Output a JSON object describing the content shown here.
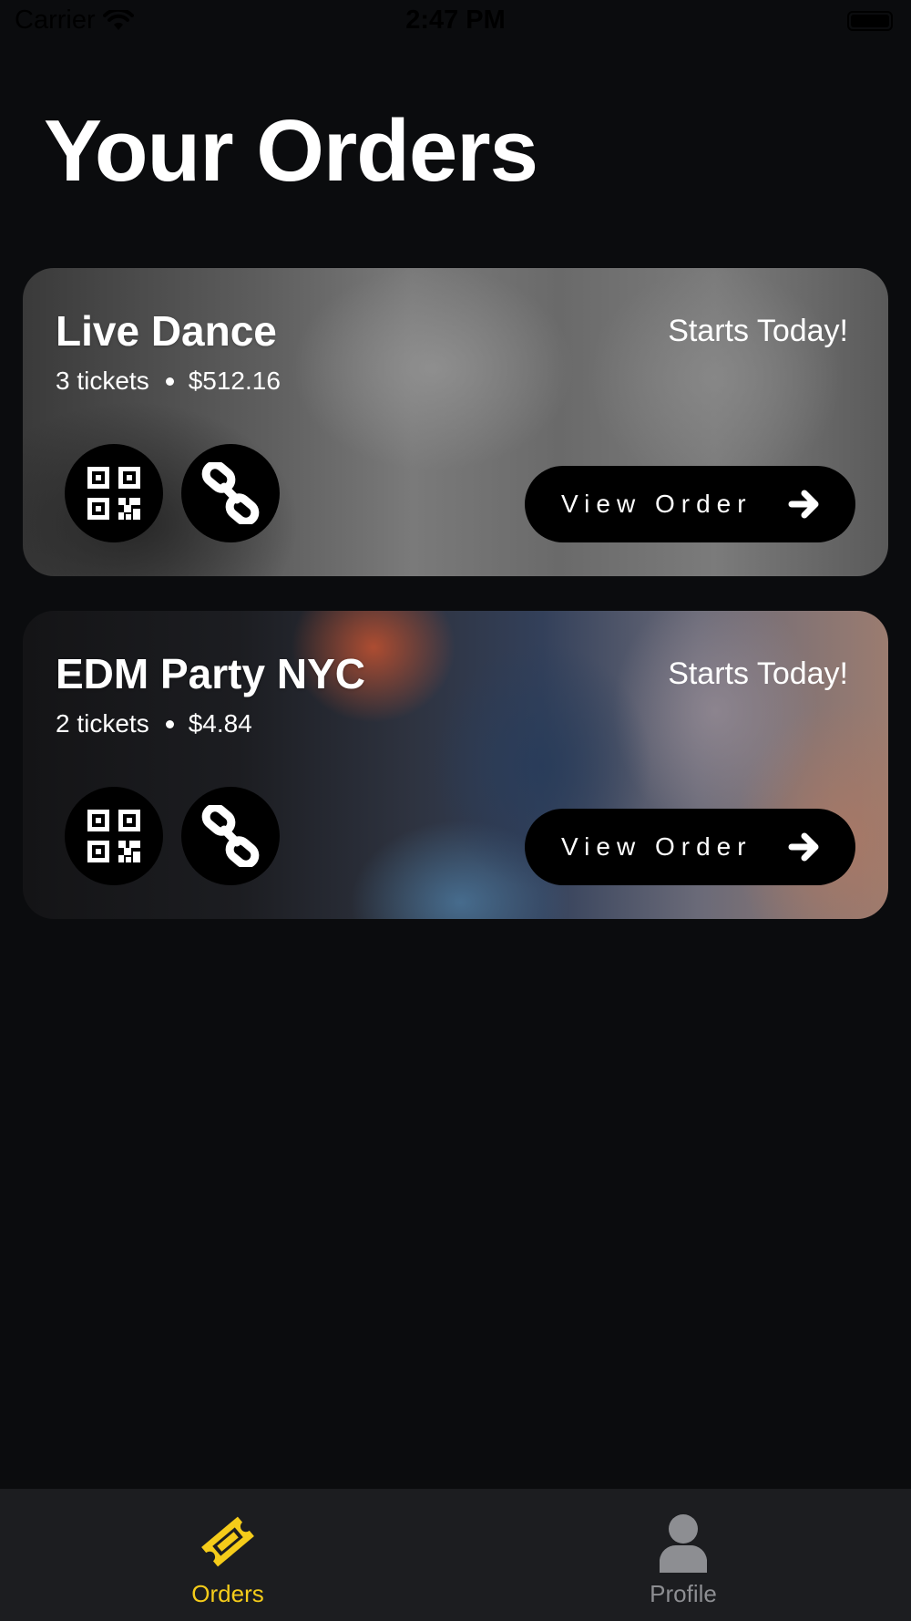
{
  "status_bar": {
    "carrier": "Carrier",
    "time": "2:47 PM"
  },
  "page": {
    "title": "Your Orders"
  },
  "orders": [
    {
      "title": "Live Dance",
      "tickets": "3 tickets",
      "price": "$512.16",
      "start": "Starts Today!",
      "view_label": "View Order"
    },
    {
      "title": "EDM Party NYC",
      "tickets": "2 tickets",
      "price": "$4.84",
      "start": "Starts Today!",
      "view_label": "View Order"
    }
  ],
  "tab_bar": {
    "tabs": [
      {
        "label": "Orders",
        "icon": "ticket-icon",
        "active": true
      },
      {
        "label": "Profile",
        "icon": "person-icon",
        "active": false
      }
    ]
  },
  "colors": {
    "background": "#0b0c0e",
    "tab_bar": "#1c1d20",
    "accent": "#f5cc1a",
    "inactive": "#8d8e92"
  }
}
